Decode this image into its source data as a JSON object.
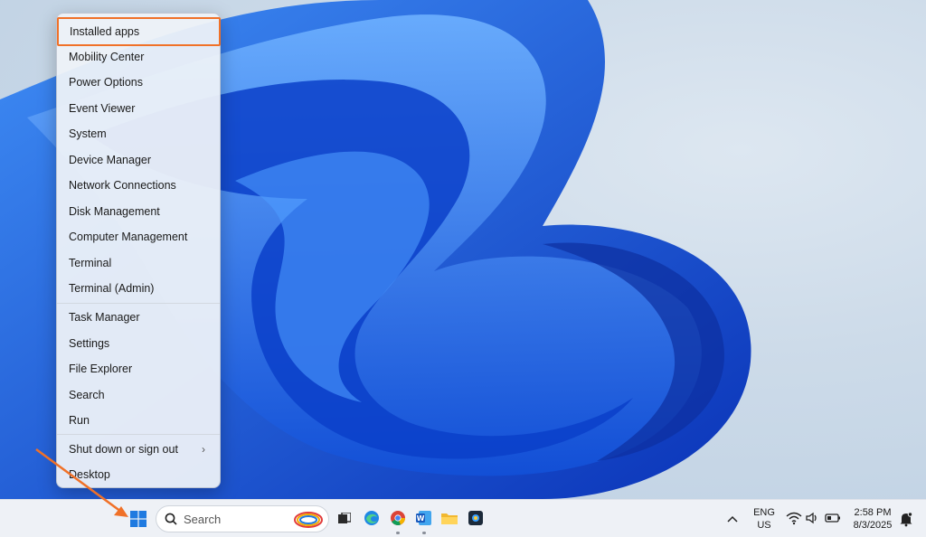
{
  "menu": {
    "group1": [
      "Installed apps",
      "Mobility Center",
      "Power Options",
      "Event Viewer",
      "System",
      "Device Manager",
      "Network Connections",
      "Disk Management",
      "Computer Management",
      "Terminal",
      "Terminal (Admin)"
    ],
    "group2": [
      "Task Manager",
      "Settings",
      "File Explorer",
      "Search",
      "Run"
    ],
    "group3": [
      "Shut down or sign out",
      "Desktop"
    ],
    "highlighted": "Installed apps"
  },
  "taskbar": {
    "search_placeholder": "Search",
    "language": "ENG",
    "region": "US",
    "time": "2:58 PM",
    "date": "8/3/2025"
  },
  "colors": {
    "highlight_border": "#f07128",
    "arrow": "#f07128",
    "windows_logo": "#1f7ae0"
  },
  "icons": [
    "start-icon",
    "search-icon",
    "task-view-icon",
    "edge-icon",
    "chrome-icon",
    "word-icon",
    "file-explorer-icon",
    "photo-app-icon",
    "chevron-up-icon",
    "wifi-icon",
    "volume-icon",
    "battery-icon",
    "notification-icon"
  ]
}
